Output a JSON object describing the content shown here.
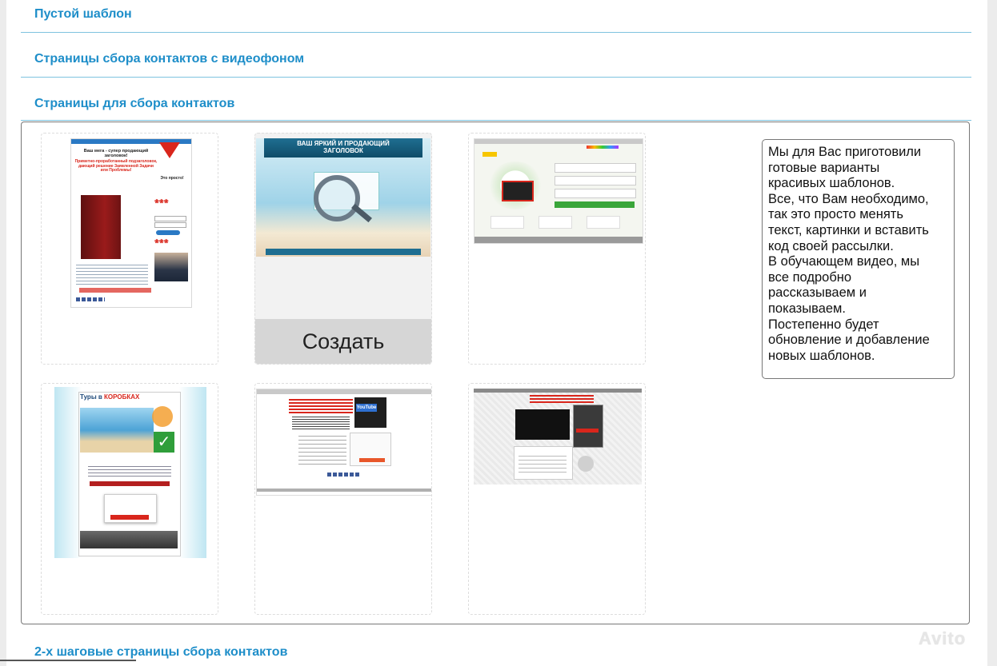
{
  "sections": {
    "empty_template": "Пустой шаблон",
    "video_background": "Страницы сбора контактов с видеофоном",
    "contact_pages": "Страницы для сбора контактов",
    "two_step": "2-х шаговые страницы сбора контактов"
  },
  "templates": {
    "create_label": "Создать",
    "t1": {
      "header": "Ваш мега - супер продающий заголовок!",
      "subheader": "Приметно-проработанный подзаголовок, дающий решение Заявленной Задачи или Проблемы!",
      "cta": "Это просто!"
    },
    "t2": {
      "header_line1": "ВАШ ЯРКИЙ И ПРОДАЮЩИЙ",
      "header_line2": "ЗАГОЛОВОК"
    },
    "t4": {
      "title_prefix": "Туры в ",
      "title_highlight": "КОРОБКАХ"
    },
    "t5": {
      "logo": "YouTube"
    }
  },
  "info": {
    "lines": [
      "Мы для Вас приготовили",
      "готовые варианты",
      "красивых шаблонов.",
      "Все, что Вам необходимо,",
      "так это просто менять",
      "текст, картинки и вставить",
      "код своей рассылки.",
      "В обучающем видео, мы",
      "все подробно",
      "рассказываем и",
      "показываем.",
      "Постепенно будет",
      "обновление и добавление",
      "новых шаблонов."
    ]
  },
  "watermark": "Avito",
  "colors": {
    "link": "#1e8ec9",
    "divider": "#7ec3df",
    "button_bg": "#d6d6d6",
    "accent_red": "#d9261c"
  }
}
